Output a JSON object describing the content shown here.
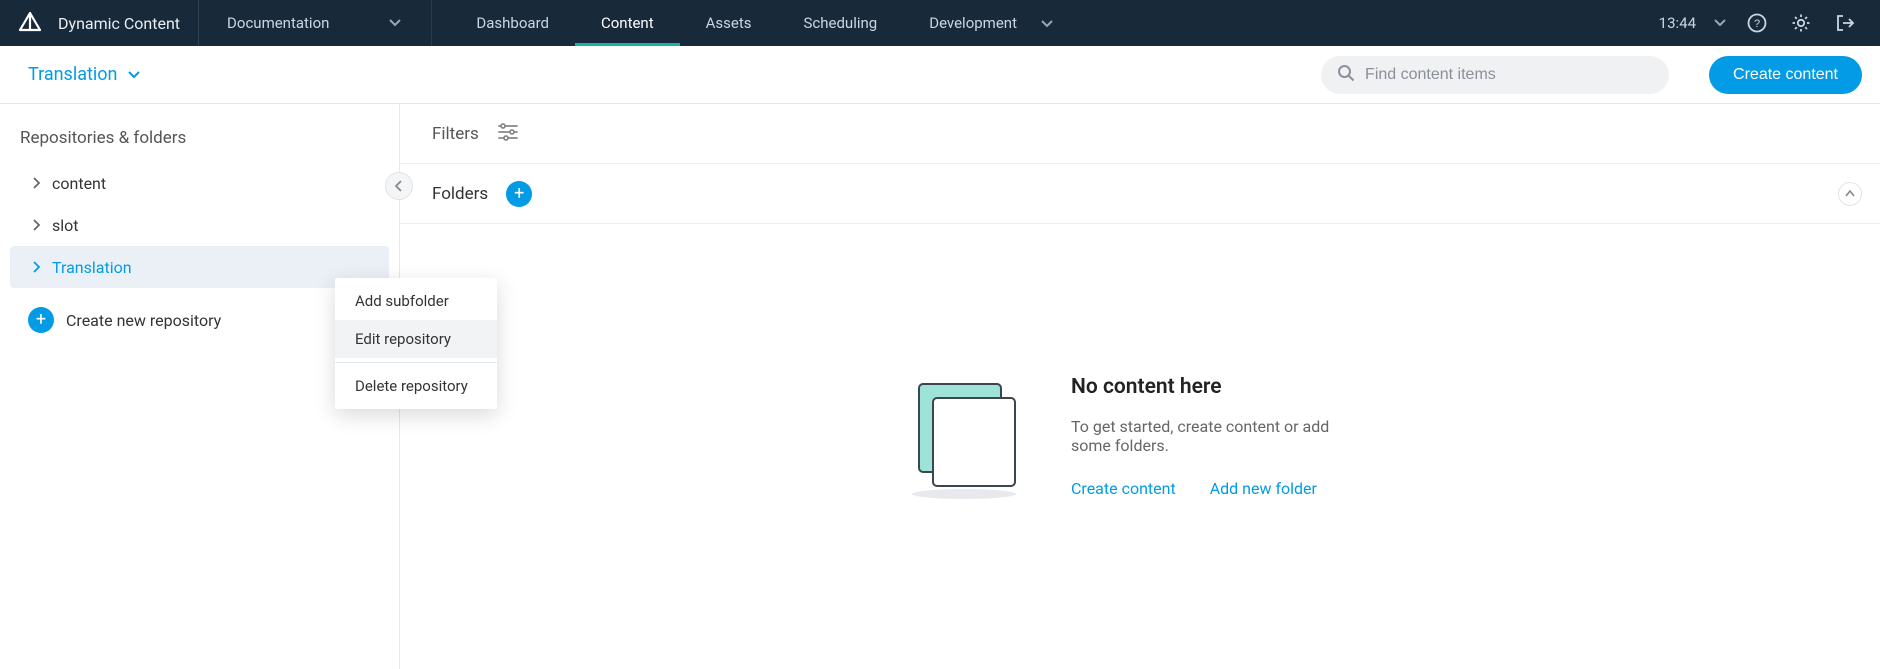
{
  "brand": "Dynamic Content",
  "doc_selector": "Documentation",
  "nav": {
    "dashboard": "Dashboard",
    "content": "Content",
    "assets": "Assets",
    "scheduling": "Scheduling",
    "development": "Development"
  },
  "time": "13:44",
  "subheader": {
    "title": "Translation",
    "search_placeholder": "Find content items",
    "create_label": "Create content"
  },
  "sidebar": {
    "heading": "Repositories & folders",
    "items": [
      {
        "label": "content"
      },
      {
        "label": "slot"
      },
      {
        "label": "Translation"
      }
    ],
    "create_repo": "Create new repository"
  },
  "context_menu": {
    "add_subfolder": "Add subfolder",
    "edit_repository": "Edit repository",
    "delete_repository": "Delete repository"
  },
  "content": {
    "filters_label": "Filters",
    "folders_label": "Folders"
  },
  "empty": {
    "title": "No content here",
    "body": "To get started, create content or add some folders.",
    "create_content": "Create content",
    "add_folder": "Add new folder"
  }
}
